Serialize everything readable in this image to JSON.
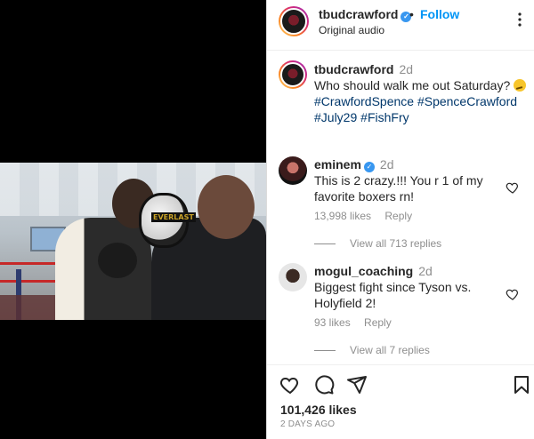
{
  "header": {
    "username": "tbudcrawford",
    "follow_label": "Follow",
    "separator": "•",
    "audio": "Original audio",
    "more_icon": "more-options-icon"
  },
  "caption": {
    "username": "tbudcrawford",
    "time": "2d",
    "text": "Who should walk me out Saturday? ",
    "hashtags": [
      "#CrawfordSpence",
      "#SpenceCrawford",
      "#July29",
      "#FishFry"
    ]
  },
  "comments": [
    {
      "username": "eminem",
      "verified": true,
      "time": "2d",
      "text": "This is 2 crazy.!!! You r 1 of my favorite boxers rn!",
      "likes": "13,998 likes",
      "reply_label": "Reply",
      "view_replies": "View all 713 replies"
    },
    {
      "username": "mogul_coaching",
      "verified": false,
      "time": "2d",
      "text": "Biggest fight since Tyson vs. Holyfield 2!",
      "likes": "93 likes",
      "reply_label": "Reply",
      "view_replies": "View all 7 replies"
    }
  ],
  "actions": {
    "icons": [
      "heart-icon",
      "comment-icon",
      "share-icon",
      "bookmark-icon"
    ],
    "likes_count": "101,426 likes",
    "date": "2 DAYS AGO"
  },
  "media": {
    "pad_brand": "EVERLAST"
  }
}
